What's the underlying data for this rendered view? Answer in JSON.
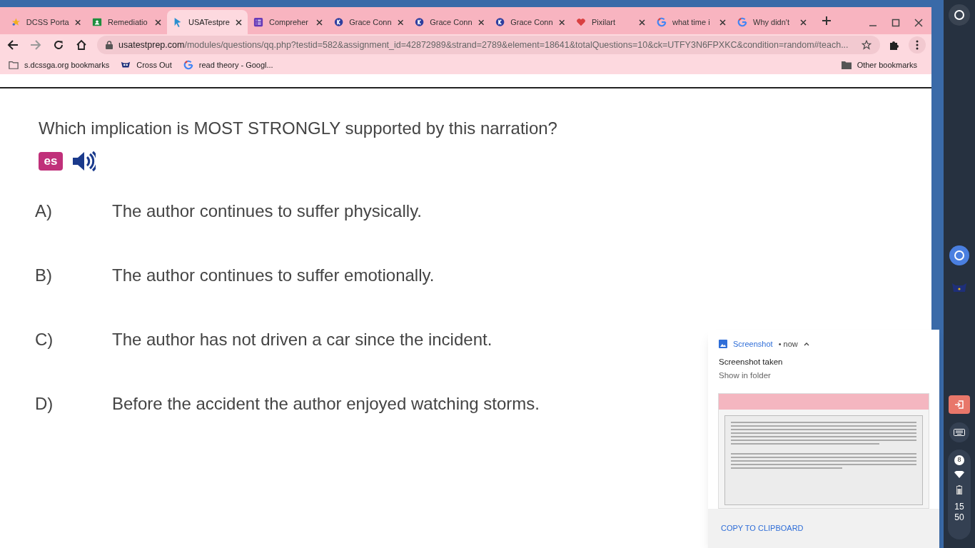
{
  "tabs": [
    {
      "title": "DCSS Porta",
      "kind": "star",
      "selected": false
    },
    {
      "title": "Remediatio",
      "kind": "classroom",
      "selected": false
    },
    {
      "title": "USATestpre",
      "kind": "cursor",
      "selected": true
    },
    {
      "title": "Compreher",
      "kind": "forms",
      "selected": false
    },
    {
      "title": "Grace Conn",
      "kind": "k",
      "selected": false
    },
    {
      "title": "Grace Conn",
      "kind": "k",
      "selected": false
    },
    {
      "title": "Grace Conn",
      "kind": "k",
      "selected": false
    },
    {
      "title": "Pixilart",
      "kind": "heart",
      "selected": false
    },
    {
      "title": "what time i",
      "kind": "google",
      "selected": false
    },
    {
      "title": "Why didn't",
      "kind": "google",
      "selected": false
    }
  ],
  "address": {
    "domain": "usatestprep.com",
    "path": "/modules/questions/qq.php?testid=582&assignment_id=42872989&strand=2789&element=18641&totalQuestions=10&ck=UTFY3N6FPXKC&condition=random#teach..."
  },
  "bookmarks": [
    {
      "label": "s.dcssga.org bookmarks",
      "kind": "folder"
    },
    {
      "label": "Cross Out",
      "kind": "owl"
    },
    {
      "label": "read theory - Googl...",
      "kind": "google"
    }
  ],
  "other_bookmarks": "Other bookmarks",
  "question": {
    "text": "Which implication is MOST STRONGLY supported by this narration?",
    "translate_badge": "es"
  },
  "answers": [
    {
      "letter": "A)",
      "text": "The author continues to suffer physically."
    },
    {
      "letter": "B)",
      "text": "The author continues to suffer emotionally."
    },
    {
      "letter": "C)",
      "text": "The author has not driven a car since the incident."
    },
    {
      "letter": "D)",
      "text": "Before the accident the author enjoyed watching storms."
    }
  ],
  "notification": {
    "app": "Screenshot",
    "time": "• now",
    "title": "Screenshot taken",
    "subtitle": "Show in folder",
    "action": "COPY TO CLIPBOARD"
  },
  "shelf": {
    "notification_count": "8",
    "clock_hours": "15",
    "clock_minutes": "50"
  }
}
